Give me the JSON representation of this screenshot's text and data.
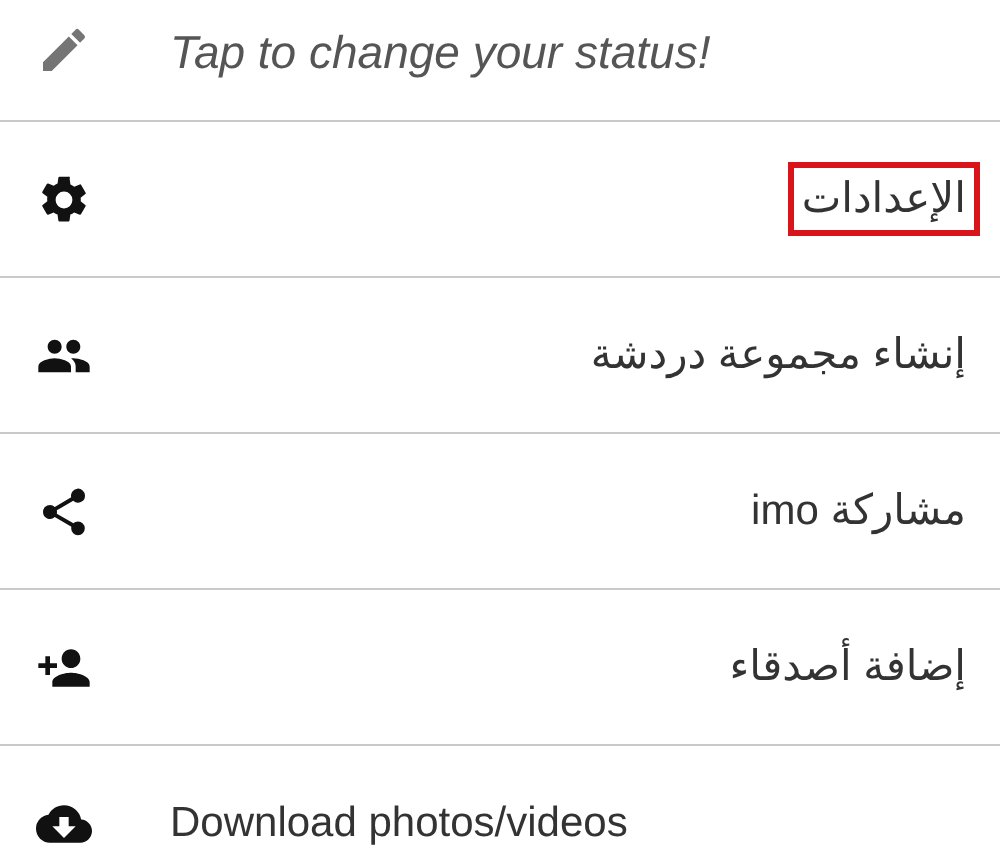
{
  "status": {
    "text": "Tap to change your status!"
  },
  "items": [
    {
      "label": "الإعدادات",
      "rtl": true,
      "highlighted": true
    },
    {
      "label": "إنشاء مجموعة دردشة",
      "rtl": true,
      "highlighted": false
    },
    {
      "label": "مشاركة imo",
      "rtl": true,
      "highlighted": false
    },
    {
      "label": "إضافة أصدقاء",
      "rtl": true,
      "highlighted": false
    },
    {
      "label": "Download photos/videos",
      "rtl": false,
      "highlighted": false
    }
  ]
}
